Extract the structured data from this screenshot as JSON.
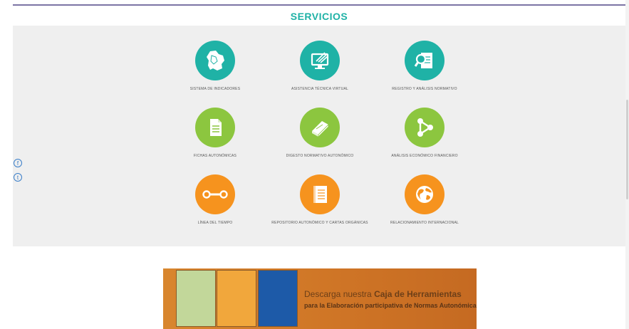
{
  "header": {
    "title": "SERVICIOS"
  },
  "services": [
    {
      "label": "SISTEMA DE INDICADORES",
      "icon": "bolivia-map-icon",
      "color": "teal"
    },
    {
      "label": "ASISTENCIA TÉCNICA VIRTUAL",
      "icon": "monitor-pen-icon",
      "color": "teal"
    },
    {
      "label": "REGISTRO Y ANÁLISIS NORMATIVO",
      "icon": "document-magnifier-icon",
      "color": "teal"
    },
    {
      "label": "FICHAS AUTONÓMICAS",
      "icon": "document-icon",
      "color": "green"
    },
    {
      "label": "DIGESTO NORMATIVO AUTONÓMICO",
      "icon": "book-icon",
      "color": "green"
    },
    {
      "label": "ANÁLISIS ECONÓMICO FINANCIERO",
      "icon": "network-nodes-icon",
      "color": "green"
    },
    {
      "label": "LÍNEA DEL TIEMPO",
      "icon": "timeline-icon",
      "color": "orange"
    },
    {
      "label": "REPOSITORIO AUTONÓMICO Y CARTAS ORGÁNICAS",
      "icon": "repository-book-icon",
      "color": "orange"
    },
    {
      "label": "RELACIONAMIENTO INTERNACIONAL",
      "icon": "globe-icon",
      "color": "orange"
    }
  ],
  "social": {
    "facebook": "f",
    "twitter": "t"
  },
  "banner": {
    "line1_a": "Descarga nuestra ",
    "line1_b": "Caja de Herramientas",
    "line2": "para la Elaboración participativa de Normas Autonómicas"
  },
  "colors": {
    "teal": "#1fb2a6",
    "green": "#8cc63f",
    "orange": "#f6931e",
    "header_rule": "#7c74a4"
  }
}
